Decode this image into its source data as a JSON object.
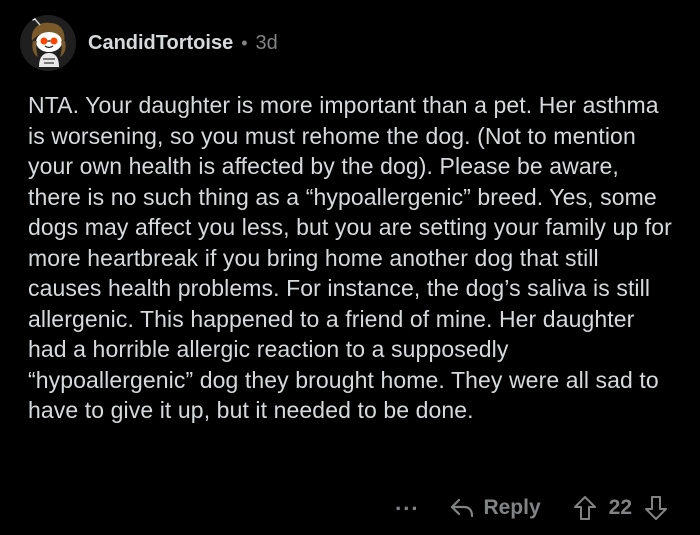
{
  "comment": {
    "username": "CandidTortoise",
    "separator": "•",
    "age": "3d",
    "body": "NTA. Your daughter is more important than a pet. Her asthma is worsening, so you must rehome the dog. (Not to mention your own health is affected by the dog). Please be aware, there is no such thing as a “hypoallergenic” breed. Yes, some dogs may affect you less, but you are setting your family up for more heartbreak if you bring home another dog that still causes health problems. For instance, the dog’s saliva is still allergenic. This happened to a friend of mine. Her daughter had a horrible allergic reaction to a supposedly “hypoallergenic” dog they brought home. They were all sad to have to give it up, but it needed to be done."
  },
  "actions": {
    "more_label": "...",
    "reply_label": "Reply",
    "vote_count": "22"
  },
  "icons": {
    "avatar": "snoo-avatar",
    "reply": "reply-arrow-icon",
    "upvote": "upvote-arrow-icon",
    "downvote": "downvote-arrow-icon"
  },
  "colors": {
    "background": "#000000",
    "text": "#d7dadc",
    "muted": "#818384"
  }
}
